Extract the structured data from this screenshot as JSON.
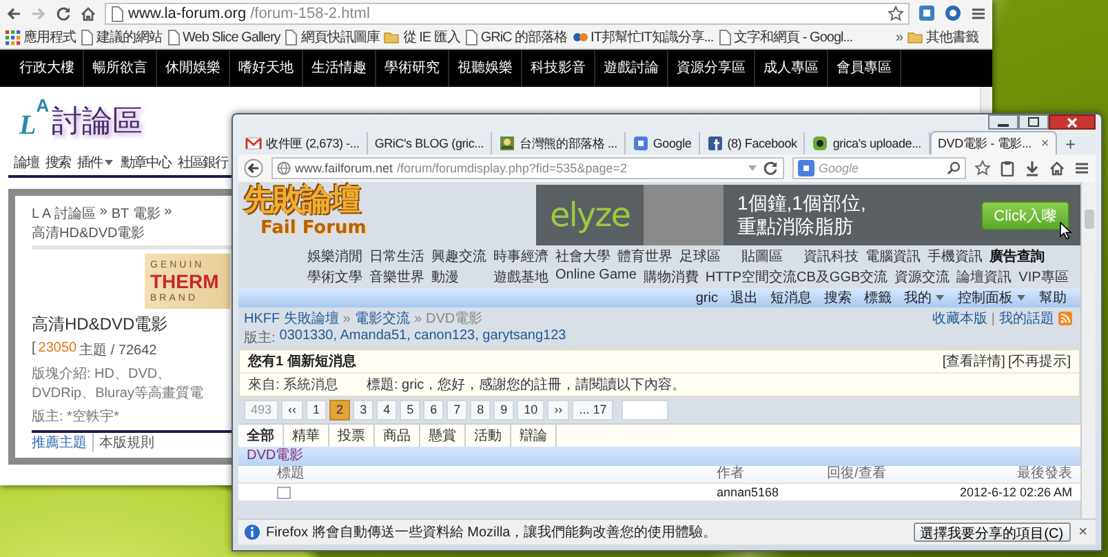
{
  "chrome_window": {
    "url": {
      "host": "www.la-forum.org",
      "path": "/forum-158-2.html"
    },
    "bookmarks": [
      {
        "kind": "apps",
        "label": "應用程式"
      },
      {
        "kind": "page",
        "label": "建議的網站"
      },
      {
        "kind": "page",
        "label": "Web Slice Gallery"
      },
      {
        "kind": "page",
        "label": "網頁快訊圖庫"
      },
      {
        "kind": "folder",
        "label": "從 IE 匯入"
      },
      {
        "kind": "page",
        "label": "GRiC 的部落格"
      },
      {
        "kind": "site",
        "label": "IT邦幫忙IT知識分享..."
      },
      {
        "kind": "page",
        "label": "文字和網頁 - Googl..."
      }
    ],
    "bookmarks_overflow": "»",
    "other_bookmarks": "其他書籤",
    "site_nav": [
      "行政大樓",
      "暢所欲言",
      "休閒娛樂",
      "嗜好天地",
      "生活情趣",
      "學術研究",
      "視聽娛樂",
      "科技影音",
      "遊戲討論",
      "資源分享區",
      "成人專區",
      "會員專區"
    ],
    "logo": {
      "letters": [
        "L",
        "A"
      ],
      "title": "討論區"
    },
    "menu": [
      {
        "label": "論壇",
        "dropdown": false
      },
      {
        "label": "搜索",
        "dropdown": false
      },
      {
        "label": "插件",
        "dropdown": true
      },
      {
        "label": "勳章中心",
        "dropdown": false
      },
      {
        "label": "社區銀行",
        "dropdown": false
      }
    ],
    "breadcrumb": {
      "items": [
        "L A 討論區",
        "BT 電影",
        "高清HD&DVD電影"
      ],
      "separator": "»"
    },
    "ad": {
      "tagline": "GENUIN",
      "brand": "THERM",
      "caption": "BRAND"
    },
    "forum": {
      "title": "高清HD&DVD電影",
      "stats_open": "[",
      "topics": "23050",
      "stats_rest": "主題 / 72642",
      "description": "版塊介紹: HD、DVD、DVDRip、Bluray等高畫質電",
      "moderators": "版主: *空軼宇*"
    },
    "footer_links": [
      {
        "label": "推薦主題",
        "kind": "link"
      },
      {
        "label": "本版規則",
        "kind": "text"
      }
    ]
  },
  "firefox_window": {
    "tabs": [
      {
        "kind": "mail",
        "label": "收件匣 (2,673) -...",
        "selected": false
      },
      {
        "kind": "plain",
        "label": "GRiC's BLOG (gric...",
        "selected": false
      },
      {
        "kind": "picture",
        "label": "台灣熊的部落格 ...",
        "selected": false
      },
      {
        "kind": "tile",
        "label": "Google",
        "selected": false
      },
      {
        "kind": "social",
        "label": "(8) Facebook",
        "selected": false
      },
      {
        "kind": "dot",
        "label": "grica's uploade...",
        "selected": false
      },
      {
        "kind": "plain",
        "label": "DVD電影 - 電影...",
        "selected": true
      }
    ],
    "tab_close": "×",
    "new_tab": "+",
    "url": {
      "host": "www.failforum.net",
      "path": "/forum/forumdisplay.php?fid=535&page=2"
    },
    "search": {
      "placeholder": "Google"
    },
    "logo": {
      "title": "先敗論壇",
      "subtitle": "Fail Forum"
    },
    "banner": {
      "brand": "elyze",
      "headline": [
        "1個鐘,1個部位,",
        "重點消除脂肪"
      ],
      "button": "Click入嚟"
    },
    "categories": [
      [
        {
          "label": "娛樂消閒",
          "bold": false
        },
        {
          "label": "日常生活",
          "bold": false
        },
        {
          "label": "興趣交流",
          "bold": false
        },
        {
          "label": "時事經濟",
          "bold": false
        },
        {
          "label": "社會大學",
          "bold": false
        },
        {
          "label": "體育世界",
          "bold": false
        },
        {
          "label": "足球區",
          "bold": false
        },
        {
          "label": "貼圖區",
          "bold": false
        },
        {
          "label": "資訊科技",
          "bold": false
        },
        {
          "label": "電腦資訊",
          "bold": false
        },
        {
          "label": "手機資訊",
          "bold": false
        },
        {
          "label": "廣告查詢",
          "bold": true
        }
      ],
      [
        {
          "label": "學術文學",
          "bold": false
        },
        {
          "label": "音樂世界",
          "bold": false
        },
        {
          "label": "動漫",
          "bold": false
        },
        {
          "label": "遊戲基地",
          "bold": false
        },
        {
          "label": "Online Game",
          "bold": false
        },
        {
          "label": "購物消費",
          "bold": false
        },
        {
          "label": "HTTP空間交流CB及GGB交流",
          "bold": false
        },
        {
          "label": "資源交流",
          "bold": false
        },
        {
          "label": "論壇資訊",
          "bold": false
        },
        {
          "label": "VIP專區",
          "bold": false
        }
      ]
    ],
    "user_bar": [
      {
        "label": "gric",
        "dropdown": false
      },
      {
        "label": "退出",
        "dropdown": false
      },
      {
        "label": "短消息",
        "dropdown": false
      },
      {
        "label": "搜索",
        "dropdown": false
      },
      {
        "label": "標籤",
        "dropdown": false
      },
      {
        "label": "我的",
        "dropdown": true
      },
      {
        "label": "控制面板",
        "dropdown": true
      },
      {
        "label": "幫助",
        "dropdown": false
      }
    ],
    "breadcrumb": {
      "links": [
        "HKFF 失敗論壇",
        "電影交流"
      ],
      "current": "DVD電影",
      "separator": "»"
    },
    "forum_links": [
      "收藏本版",
      "我的話題"
    ],
    "forum_links_separator": "|",
    "moderators": {
      "label": "版主:",
      "names": "0301330, Amanda51, canon123, garytsang123"
    },
    "notice": {
      "title": "您有1 個新短消息",
      "actions": [
        "[查看詳情]",
        "[不再提示]"
      ],
      "from": "來自: 系統消息",
      "subject": "標題: gric，您好，感謝您的註冊，請閱讀以下內容。"
    },
    "pagination": {
      "total": "493",
      "first": "‹‹",
      "pages": [
        {
          "label": "1",
          "selected": false
        },
        {
          "label": "2",
          "selected": true
        },
        {
          "label": "3",
          "selected": false
        },
        {
          "label": "4",
          "selected": false
        },
        {
          "label": "5",
          "selected": false
        },
        {
          "label": "6",
          "selected": false
        },
        {
          "label": "7",
          "selected": false
        },
        {
          "label": "8",
          "selected": false
        },
        {
          "label": "9",
          "selected": false
        },
        {
          "label": "10",
          "selected": false
        }
      ],
      "next": "››",
      "last": "... 17"
    },
    "filters": [
      {
        "label": "全部",
        "selected": true
      },
      {
        "label": "精華",
        "selected": false
      },
      {
        "label": "投票",
        "selected": false
      },
      {
        "label": "商品",
        "selected": false
      },
      {
        "label": "懸賞",
        "selected": false
      },
      {
        "label": "活動",
        "selected": false
      },
      {
        "label": "辯論",
        "selected": false
      }
    ],
    "section": "DVD電影",
    "columns": [
      "標題",
      "作者",
      "回復/查看",
      "最後發表"
    ],
    "rows": [
      {
        "author": "annan5168",
        "last_post": "2012-6-12 02:26 AM"
      }
    ],
    "notification": {
      "text": "Firefox 將會自動傳送一些資料給 Mozilla，讓我們能夠改善您的使用體驗。",
      "button": "選擇我要分享的項目(C)",
      "close": "×"
    }
  }
}
